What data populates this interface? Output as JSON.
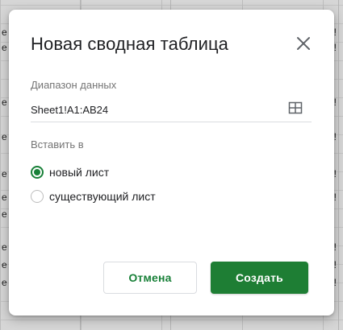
{
  "background_sheet": {
    "left_cell_glyphs": [
      "e",
      "e",
      "e",
      "e",
      "e",
      "e",
      "e",
      "e",
      "e",
      "e",
      "e"
    ],
    "right_cell_glyphs": [
      "!",
      "!",
      "!",
      "!",
      "!",
      "!",
      "!",
      "!",
      "!"
    ]
  },
  "dialog": {
    "title": "Новая сводная таблица",
    "close_icon": "close-icon",
    "range": {
      "label": "Диапазон данных",
      "value": "Sheet1!A1:AB24",
      "select_icon": "grid-icon"
    },
    "insert": {
      "label": "Вставить в",
      "options": [
        {
          "label": "новый лист",
          "selected": true
        },
        {
          "label": "существующий лист",
          "selected": false
        }
      ]
    },
    "buttons": {
      "cancel": "Отмена",
      "create": "Создать"
    }
  },
  "colors": {
    "accent": "#188038",
    "primary_button": "#1e7e34",
    "text": "#202124",
    "label": "#757575",
    "overlay": "#cfcfcf"
  }
}
